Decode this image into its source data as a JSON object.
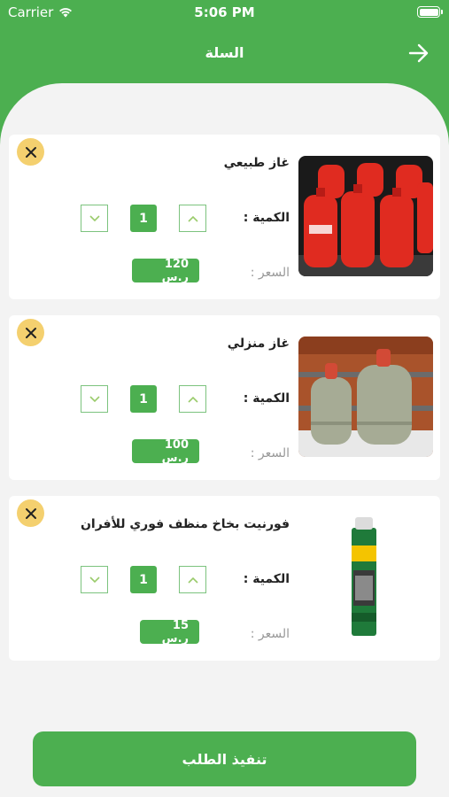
{
  "status_bar": {
    "carrier": "Carrier",
    "time": "5:06 PM"
  },
  "header": {
    "title": "السلة"
  },
  "cart": {
    "qty_label": "الكمية :",
    "price_label": "السعر :",
    "items": [
      {
        "name": "غاز طبيعي",
        "quantity": "1",
        "price": "120 ر.س",
        "image": "red-gas-cylinders"
      },
      {
        "name": "غاز منزلي",
        "quantity": "1",
        "price": "100 ر.س",
        "image": "grey-gas-cylinders"
      },
      {
        "name": "فورنيت بخاخ منظف فوري للأفران",
        "quantity": "1",
        "price": "15 ر.س",
        "image": "oven-cleaner-spray"
      }
    ]
  },
  "checkout": {
    "label": "تنفيذ الطلب"
  },
  "colors": {
    "primary": "#4caf50",
    "remove_button": "#f4d06f",
    "background": "#f3f3f3"
  }
}
